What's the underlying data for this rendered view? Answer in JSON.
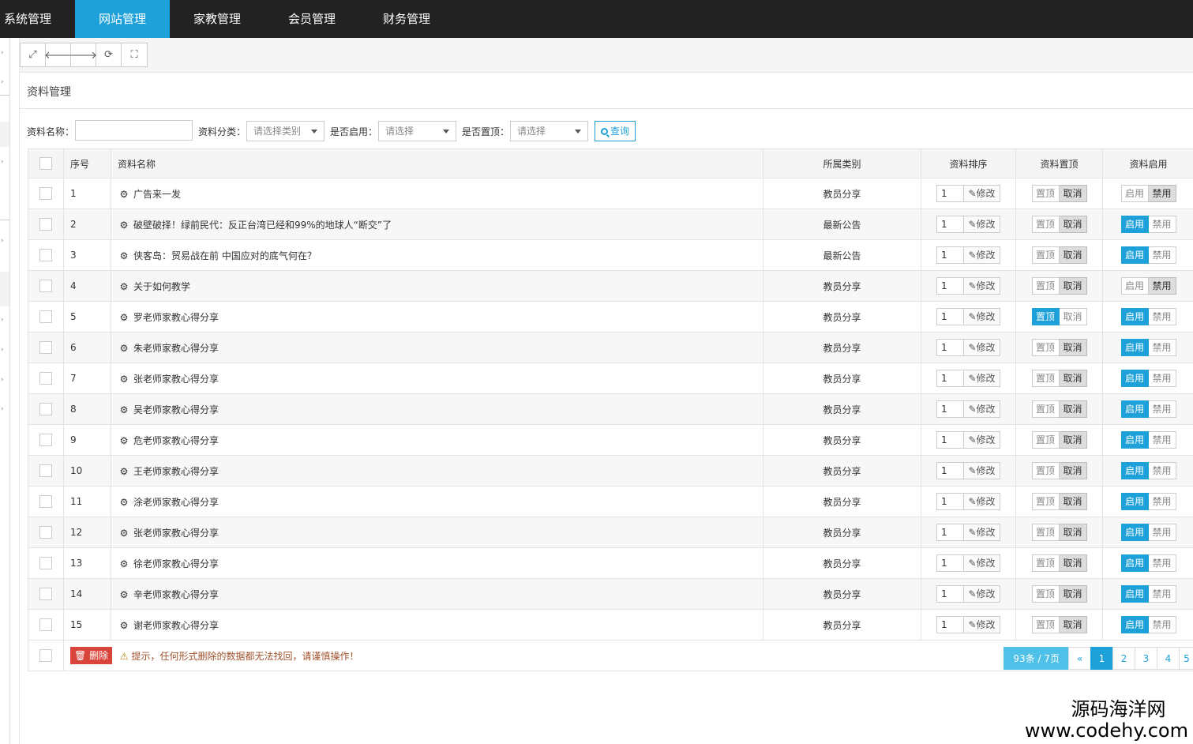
{
  "topnav": {
    "items": [
      {
        "label": "系统管理",
        "active": false
      },
      {
        "label": "网站管理",
        "active": true
      },
      {
        "label": "家教管理",
        "active": false
      },
      {
        "label": "会员管理",
        "active": false
      },
      {
        "label": "财务管理",
        "active": false
      }
    ]
  },
  "toolbar": {
    "icons": [
      "expand-icon",
      "arrow-left-icon",
      "arrow-right-icon",
      "refresh-icon",
      "fullscreen-icon"
    ]
  },
  "panel": {
    "title": "资料管理"
  },
  "filters": {
    "name_label": "资料名称：",
    "name_value": "",
    "category_label": "资料分类：",
    "category_selected": "请选择类别",
    "enabled_label": "是否启用：",
    "enabled_selected": "请选择",
    "top_label": "是否置顶：",
    "top_selected": "请选择",
    "search_label": "查询"
  },
  "table": {
    "headers": {
      "index": "序号",
      "name": "资料名称",
      "category": "所属类别",
      "sort": "资料排序",
      "top": "资料置顶",
      "enable": "资料启用"
    },
    "labels": {
      "modify": "修改",
      "top_on": "置顶",
      "top_off": "取消",
      "enable_on": "启用",
      "enable_off": "禁用"
    },
    "rows": [
      {
        "index": "1",
        "name": "广告来一发",
        "category": "教员分享",
        "sort": "1",
        "top_state": "off",
        "enable_state": "off"
      },
      {
        "index": "2",
        "name": "破壁破择！绿前民代：反正台湾已经和99%的地球人“断交”了",
        "category": "最新公告",
        "sort": "1",
        "top_state": "off",
        "enable_state": "on"
      },
      {
        "index": "3",
        "name": "侠客岛：贸易战在前 中国应对的底气何在？",
        "category": "最新公告",
        "sort": "1",
        "top_state": "off",
        "enable_state": "on"
      },
      {
        "index": "4",
        "name": "关于如何教学",
        "category": "教员分享",
        "sort": "1",
        "top_state": "off",
        "enable_state": "off"
      },
      {
        "index": "5",
        "name": "罗老师家教心得分享",
        "category": "教员分享",
        "sort": "1",
        "top_state": "on",
        "enable_state": "on"
      },
      {
        "index": "6",
        "name": "朱老师家教心得分享",
        "category": "教员分享",
        "sort": "1",
        "top_state": "off",
        "enable_state": "on"
      },
      {
        "index": "7",
        "name": "张老师家教心得分享",
        "category": "教员分享",
        "sort": "1",
        "top_state": "off",
        "enable_state": "on"
      },
      {
        "index": "8",
        "name": "吴老师家教心得分享",
        "category": "教员分享",
        "sort": "1",
        "top_state": "off",
        "enable_state": "on"
      },
      {
        "index": "9",
        "name": "危老师家教心得分享",
        "category": "教员分享",
        "sort": "1",
        "top_state": "off",
        "enable_state": "on"
      },
      {
        "index": "10",
        "name": "王老师家教心得分享",
        "category": "教员分享",
        "sort": "1",
        "top_state": "off",
        "enable_state": "on"
      },
      {
        "index": "11",
        "name": "涂老师家教心得分享",
        "category": "教员分享",
        "sort": "1",
        "top_state": "off",
        "enable_state": "on"
      },
      {
        "index": "12",
        "name": "张老师家教心得分享",
        "category": "教员分享",
        "sort": "1",
        "top_state": "off",
        "enable_state": "on"
      },
      {
        "index": "13",
        "name": "徐老师家教心得分享",
        "category": "教员分享",
        "sort": "1",
        "top_state": "off",
        "enable_state": "on"
      },
      {
        "index": "14",
        "name": "辛老师家教心得分享",
        "category": "教员分享",
        "sort": "1",
        "top_state": "off",
        "enable_state": "on"
      },
      {
        "index": "15",
        "name": "谢老师家教心得分享",
        "category": "教员分享",
        "sort": "1",
        "top_state": "off",
        "enable_state": "on"
      }
    ]
  },
  "footer": {
    "delete_label": "删除",
    "warning_text": "提示，任何形式删除的数据都无法找回，请谨慎操作！",
    "pager": {
      "total": "93条 / 7页",
      "prev": "«",
      "pages": [
        "1",
        "2",
        "3",
        "4",
        "5"
      ],
      "current": "1"
    }
  },
  "watermark": {
    "line1": "源码海洋网",
    "line2": "www.codehy.com"
  },
  "colors": {
    "accent": "#1ea0d8",
    "nav_bg": "#222222",
    "danger": "#d9443a"
  }
}
